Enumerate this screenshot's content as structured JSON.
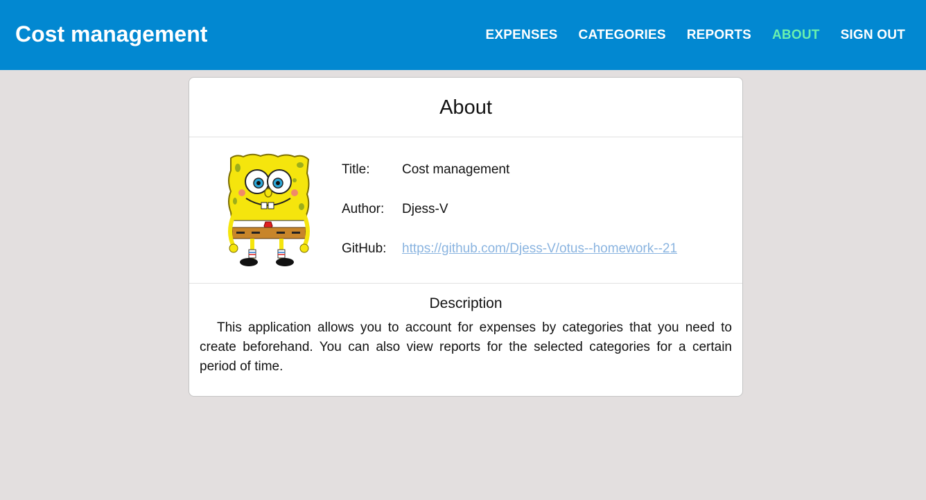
{
  "header": {
    "brand": "Cost management",
    "nav": [
      {
        "label": "EXPENSES",
        "active": false
      },
      {
        "label": "CATEGORIES",
        "active": false
      },
      {
        "label": "REPORTS",
        "active": false
      },
      {
        "label": "ABOUT",
        "active": true
      },
      {
        "label": "SIGN OUT",
        "active": false
      }
    ]
  },
  "about": {
    "title": "About",
    "avatar_icon": "spongebob-avatar",
    "rows": [
      {
        "label": "Title:",
        "value": "Cost management"
      },
      {
        "label": "Author:",
        "value": "Djess-V"
      },
      {
        "label": "GitHub:",
        "value": "https://github.com/Djess-V/otus--homework--21"
      }
    ],
    "description_title": "Description",
    "description": "This application allows you to account for expenses by categories that you need to create beforehand. You can also view reports for the selected categories for a certain period of time."
  },
  "colors": {
    "header_bg": "#0288d1",
    "active_nav": "#69f0ae",
    "page_bg": "#e3dfdf",
    "link": "#8ab4e0"
  }
}
